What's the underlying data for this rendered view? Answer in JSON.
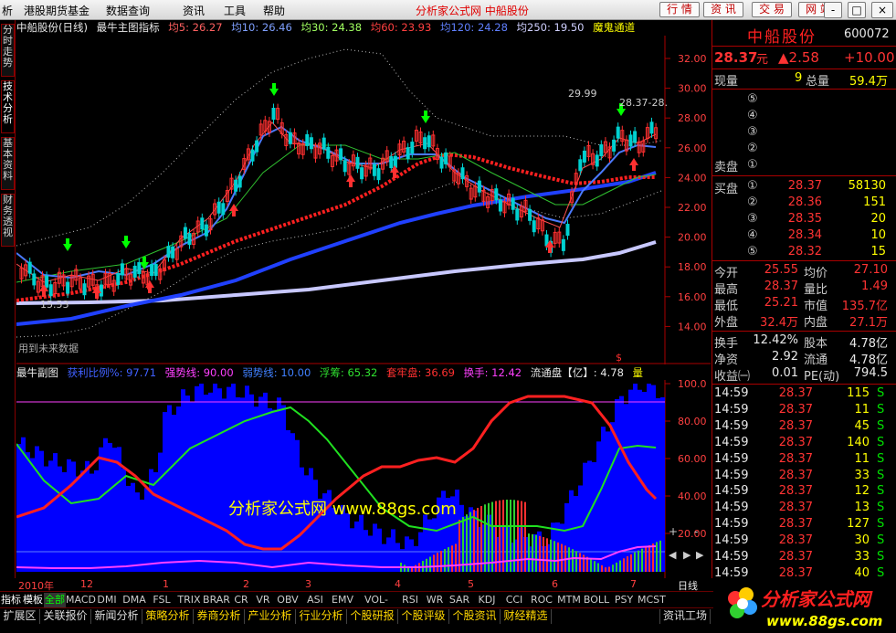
{
  "menu": [
    "析",
    "港股期货基金",
    "数据查询",
    "资讯",
    "工具",
    "帮助"
  ],
  "app_title": "分析家公式网 中船股份",
  "top_buttons": [
    "行 情",
    "资 讯",
    "交 易",
    "网 站"
  ],
  "window_buttons": [
    "-",
    "□",
    "×"
  ],
  "left_tabs": [
    "分时走势",
    "技术分析",
    "基本资料",
    "财务透视"
  ],
  "main_header": {
    "name": "中船股份(日线)",
    "indicator": "最牛主图指标",
    "ma5": "均5: 26.27",
    "ma10": "均10: 26.46",
    "ma30": "均30: 24.38",
    "ma60": "均60: 23.93",
    "ma120": "均120: 24.28",
    "ma250": "均250: 19.50",
    "channel": "魔鬼通道"
  },
  "main_labels": {
    "future_note": "用到未来数据",
    "low_label": "15.53",
    "high_label": "29.99",
    "last_label": "28.37-28.",
    "dollar_marker": "$"
  },
  "sub_header": {
    "name": "最牛副图",
    "profit": "获利比例%: 97.71",
    "strong": "强势线: 90.00",
    "weak": "弱势线: 10.00",
    "float_chips": "浮筹: 65.32",
    "locked": "套牢盘: 36.69",
    "turnover": "换手: 12.42",
    "float_cap": "流通盘【亿】: 4.78",
    "unit": "量"
  },
  "watermark": "分析家公式网 www.88gs.com",
  "main_axis": [
    "32.00",
    "30.00",
    "28.00",
    "26.00",
    "24.00",
    "22.00",
    "20.00",
    "18.00",
    "16.00",
    "14.00"
  ],
  "sub_axis": [
    "100.0",
    "80.00",
    "60.00",
    "40.00",
    "20.00"
  ],
  "quote": {
    "name": "中船股份",
    "code": "600072",
    "price": "28.37",
    "price_unit": "元",
    "change": "▲2.58",
    "change_pct": "+10.00",
    "now_vol_label": "现量",
    "now_vol": "9",
    "total_vol_label": "总量",
    "total_vol": "59.4万",
    "sell_label": "卖盘",
    "buy_label": "买盘",
    "sell_levels": [
      "⑤",
      "④",
      "③",
      "②",
      "①"
    ],
    "buy_levels": [
      {
        "lv": "①",
        "price": "28.37",
        "vol": "58130"
      },
      {
        "lv": "②",
        "price": "28.36",
        "vol": "151"
      },
      {
        "lv": "③",
        "price": "28.35",
        "vol": "20"
      },
      {
        "lv": "④",
        "price": "28.34",
        "vol": "10"
      },
      {
        "lv": "⑤",
        "price": "28.32",
        "vol": "15"
      }
    ],
    "stats": [
      {
        "l1": "今开",
        "v1": "25.55",
        "l2": "均价",
        "v2": "27.10"
      },
      {
        "l1": "最高",
        "v1": "28.37",
        "l2": "量比",
        "v2": "1.49"
      },
      {
        "l1": "最低",
        "v1": "25.21",
        "l2": "市值",
        "v2": "135.7亿"
      },
      {
        "l1": "外盘",
        "v1": "32.4万",
        "l2": "内盘",
        "v2": "27.1万"
      }
    ],
    "stats2": [
      {
        "l1": "换手",
        "v1": "12.42%",
        "l2": "股本",
        "v2": "4.78亿"
      },
      {
        "l1": "净资",
        "v1": "2.92",
        "l2": "流通",
        "v2": "4.78亿"
      },
      {
        "l1": "收益㈠",
        "v1": "0.01",
        "l2": "PE(动)",
        "v2": "794.5"
      }
    ],
    "ticks": [
      {
        "t": "14:59",
        "p": "28.37",
        "v": "115",
        "s": "S"
      },
      {
        "t": "14:59",
        "p": "28.37",
        "v": "11",
        "s": "S"
      },
      {
        "t": "14:59",
        "p": "28.37",
        "v": "45",
        "s": "S"
      },
      {
        "t": "14:59",
        "p": "28.37",
        "v": "140",
        "s": "S"
      },
      {
        "t": "14:59",
        "p": "28.37",
        "v": "11",
        "s": "S"
      },
      {
        "t": "14:59",
        "p": "28.37",
        "v": "33",
        "s": "S"
      },
      {
        "t": "14:59",
        "p": "28.37",
        "v": "12",
        "s": "S"
      },
      {
        "t": "14:59",
        "p": "28.37",
        "v": "13",
        "s": "S"
      },
      {
        "t": "14:59",
        "p": "28.37",
        "v": "127",
        "s": "S"
      },
      {
        "t": "14:59",
        "p": "28.37",
        "v": "30",
        "s": "S"
      },
      {
        "t": "14:59",
        "p": "28.37",
        "v": "33",
        "s": "S"
      },
      {
        "t": "14:59",
        "p": "28.37",
        "v": "40",
        "s": "S"
      }
    ]
  },
  "date_bar": {
    "year": "2010年",
    "months": [
      "12",
      "1",
      "2",
      "3",
      "4",
      "5",
      "6",
      "7"
    ]
  },
  "period": "日线",
  "indicator_tabs": [
    "指标",
    "模板",
    "全部",
    "MACD",
    "DMI",
    "DMA",
    "FSL",
    "TRIX",
    "BRAR",
    "CR",
    "VR",
    "OBV",
    "ASI",
    "EMV",
    "VOL-TDX",
    "RSI",
    "WR",
    "SAR",
    "KDJ",
    "CCI",
    "ROC",
    "MTM",
    "BOLL",
    "PSY",
    "MCST"
  ],
  "bottom_tabs": [
    "扩展区",
    "关联报价",
    "新闻分析",
    "策略分析",
    "券商分析",
    "产业分析",
    "行业分析",
    "个股研报",
    "个股评级",
    "个股资讯",
    "财经精选"
  ],
  "right_bottom_tab": "资讯工场",
  "logo_text": "分析家公式网",
  "logo_url": "www.88gs.com",
  "colors": {
    "up": "#ff3333",
    "down": "#00e000",
    "accent": "#ffff00",
    "ma_blue": "#3050ff",
    "profit": "#0000ff"
  }
}
